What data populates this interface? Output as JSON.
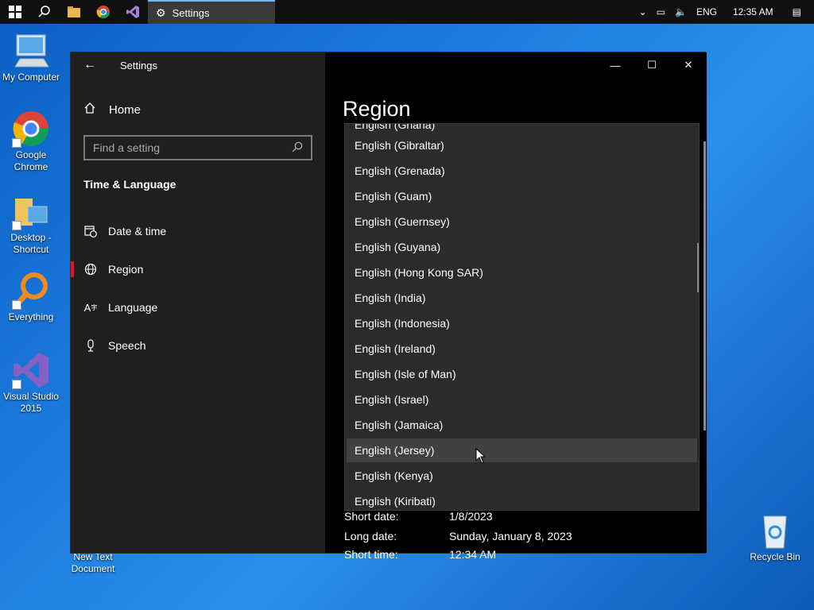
{
  "taskbar": {
    "app_label": "Settings",
    "language": "ENG",
    "time": "12:35 AM"
  },
  "desktop": {
    "icons": [
      {
        "label": "My Computer",
        "icon": "computer-icon"
      },
      {
        "label": "Google Chrome",
        "icon": "chrome-icon"
      },
      {
        "label": "Desktop - Shortcut",
        "icon": "folder-icon"
      },
      {
        "label": "Everything",
        "icon": "magnifier-icon"
      },
      {
        "label": "Visual Studio 2015",
        "icon": "visual-studio-icon"
      },
      {
        "label": "New Text Document",
        "icon": "text-document-icon"
      },
      {
        "label": "Recycle Bin",
        "icon": "recycle-bin-icon"
      }
    ]
  },
  "window": {
    "title": "Settings",
    "sidebar": {
      "home_label": "Home",
      "search_placeholder": "Find a setting",
      "section_heading": "Time & Language",
      "items": [
        {
          "label": "Date & time",
          "icon": "calendar-clock-icon",
          "active": false
        },
        {
          "label": "Region",
          "icon": "globe-icon",
          "active": true
        },
        {
          "label": "Language",
          "icon": "language-icon",
          "active": false
        },
        {
          "label": "Speech",
          "icon": "microphone-icon",
          "active": false
        }
      ]
    },
    "content": {
      "page_title": "Region",
      "dropdown": {
        "partial_top": "English (Ghana)",
        "options": [
          "English (Gibraltar)",
          "English (Grenada)",
          "English (Guam)",
          "English (Guernsey)",
          "English (Guyana)",
          "English (Hong Kong SAR)",
          "English (India)",
          "English (Indonesia)",
          "English (Ireland)",
          "English (Isle of Man)",
          "English (Israel)",
          "English (Jamaica)",
          "English (Jersey)",
          "English (Kenya)",
          "English (Kiribati)"
        ],
        "hovered": "English (Jersey)"
      },
      "format_rows": [
        {
          "label": "Short date:",
          "value": "1/8/2023"
        },
        {
          "label": "Long date:",
          "value": "Sunday, January 8, 2023"
        },
        {
          "label": "Short time:",
          "value": "12:34 AM"
        }
      ]
    }
  },
  "colors": {
    "accent": "#e81123",
    "sidebar_bg": "#1f1f1f",
    "dropdown_bg": "#2b2b2b",
    "hover_bg": "#414141"
  }
}
